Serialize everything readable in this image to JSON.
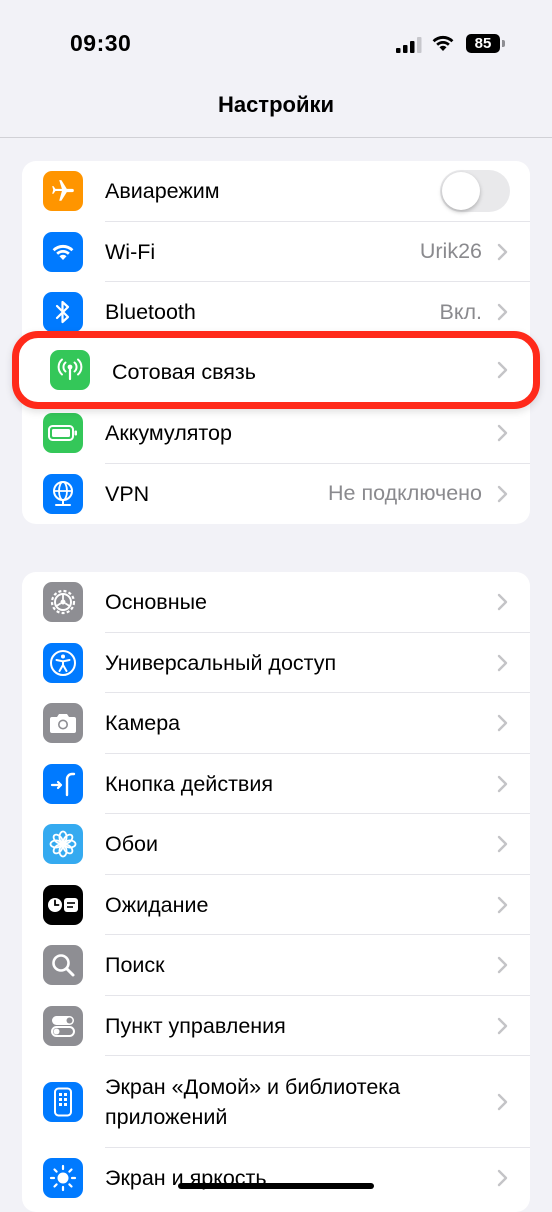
{
  "status_bar": {
    "time": "09:30",
    "battery_level": "85",
    "icons": [
      "signal-icon",
      "wifi-icon",
      "battery-icon"
    ]
  },
  "nav": {
    "title": "Настройки"
  },
  "group1": {
    "items": [
      {
        "label": "Авиарежим",
        "icon": "airplane-icon",
        "color": "#ff9500",
        "toggle": false
      },
      {
        "label": "Wi-Fi",
        "value": "Urik26",
        "icon": "wifi-icon",
        "color": "#007aff"
      },
      {
        "label": "Bluetooth",
        "value": "Вкл.",
        "icon": "bluetooth-icon",
        "color": "#007aff"
      },
      {
        "label": "Сотовая связь",
        "icon": "cellular-antenna-icon",
        "color": "#34c759",
        "highlighted": true
      },
      {
        "label": "Аккумулятор",
        "icon": "battery-icon",
        "color": "#34c759"
      },
      {
        "label": "VPN",
        "value": "Не подключено",
        "icon": "vpn-globe-icon",
        "color": "#007aff"
      }
    ]
  },
  "group2": {
    "items": [
      {
        "label": "Основные",
        "icon": "gear-icon",
        "color": "#8e8e93"
      },
      {
        "label": "Универсальный доступ",
        "icon": "accessibility-icon",
        "color": "#007aff"
      },
      {
        "label": "Камера",
        "icon": "camera-icon",
        "color": "#8e8e93"
      },
      {
        "label": "Кнопка действия",
        "icon": "action-button-icon",
        "color": "#007aff"
      },
      {
        "label": "Обои",
        "icon": "wallpaper-flower-icon",
        "color": "#35aaf0"
      },
      {
        "label": "Ожидание",
        "icon": "standby-icon",
        "color": "#000000"
      },
      {
        "label": "Поиск",
        "icon": "search-icon",
        "color": "#8e8e93"
      },
      {
        "label": "Пункт управления",
        "icon": "control-center-icon",
        "color": "#8e8e93"
      },
      {
        "label": "Экран «Домой» и библиотека приложений",
        "icon": "home-screen-icon",
        "color": "#007aff"
      },
      {
        "label": "Экран и яркость",
        "icon": "brightness-sun-icon",
        "color": "#007aff"
      }
    ]
  }
}
